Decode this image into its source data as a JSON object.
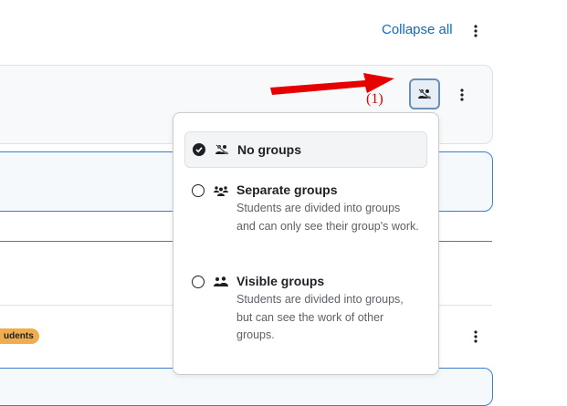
{
  "header": {
    "collapse_all": "Collapse all"
  },
  "section": {
    "badge": "udents"
  },
  "annotation": {
    "label": "(1)",
    "color": "#e60000"
  },
  "group_mode_menu": {
    "current_icon": "no-groups-icon",
    "options": [
      {
        "title": "No groups",
        "description": "",
        "icon": "no-groups-icon",
        "selected": true
      },
      {
        "title": "Separate groups",
        "description": "Students are divided into groups and can only see their group's work.",
        "icon": "separate-groups-icon",
        "selected": false
      },
      {
        "title": "Visible groups",
        "description": "Students are divided into groups, but can see the work of other groups.",
        "icon": "visible-groups-icon",
        "selected": false
      }
    ]
  },
  "colors": {
    "link": "#0f6cbf",
    "badge": "#f0ad4e",
    "card_border": "#3a80c8"
  }
}
